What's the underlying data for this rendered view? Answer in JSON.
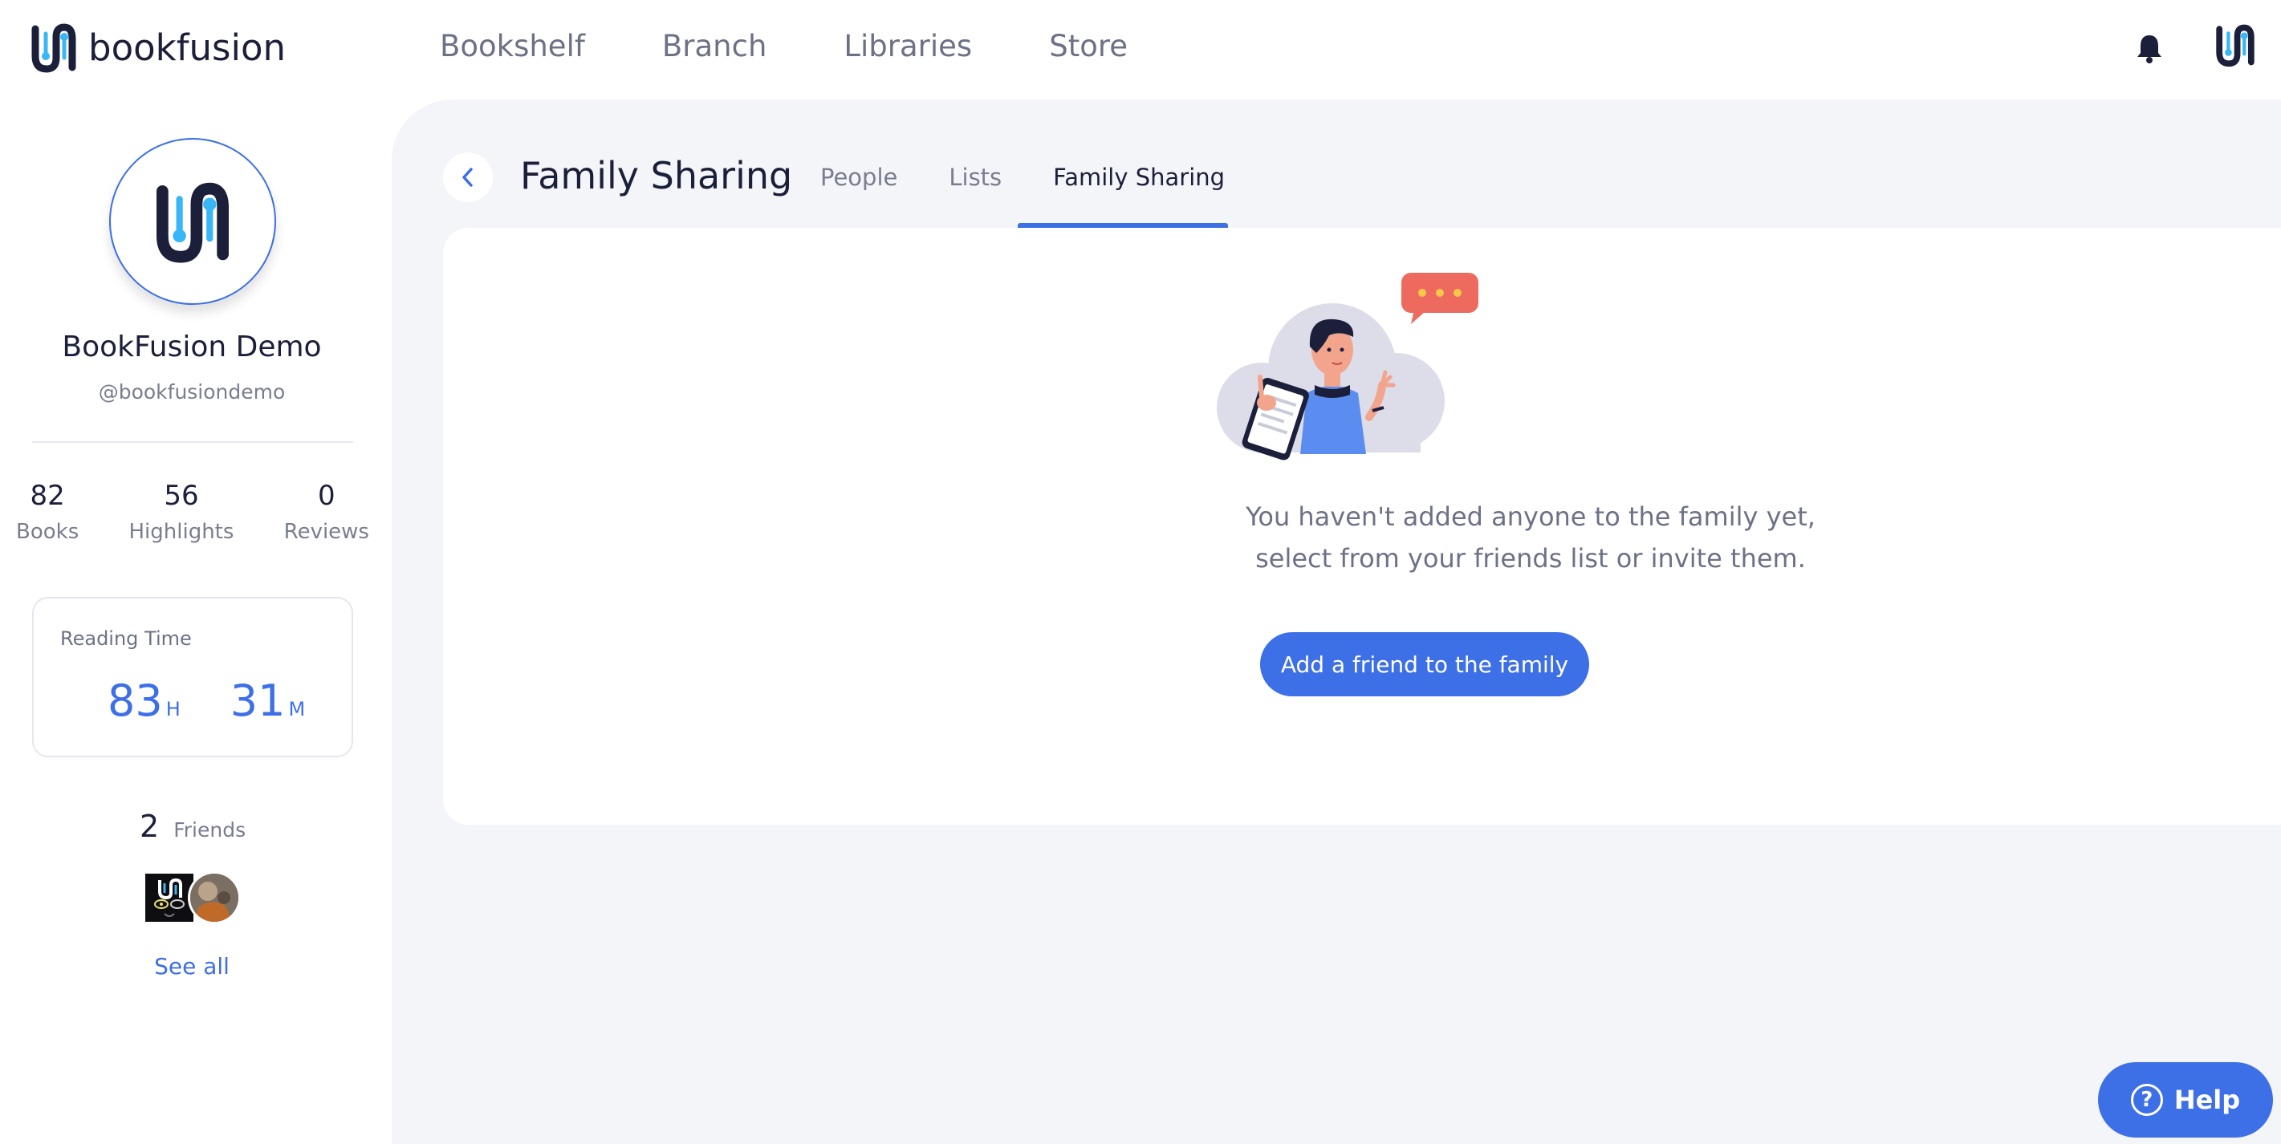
{
  "brand": {
    "name": "bookfusion",
    "color": "#3d6fe6"
  },
  "nav": {
    "items": [
      {
        "label": "Bookshelf"
      },
      {
        "label": "Branch"
      },
      {
        "label": "Libraries"
      },
      {
        "label": "Store"
      }
    ],
    "icons": [
      "bell-icon",
      "user-avatar"
    ]
  },
  "profile": {
    "name": "BookFusion Demo",
    "handle": "@bookfusiondemo",
    "stats": [
      {
        "value": "82",
        "label": "Books"
      },
      {
        "value": "56",
        "label": "Highlights"
      },
      {
        "value": "0",
        "label": "Reviews"
      }
    ],
    "reading_time": {
      "title": "Reading Time",
      "hours": "83",
      "hours_unit": "H",
      "minutes": "31",
      "minutes_unit": "M"
    },
    "friends": {
      "count": "2",
      "label": "Friends",
      "see_all": "See all"
    }
  },
  "page": {
    "title": "Family Sharing",
    "tabs": [
      {
        "label": "People",
        "active": false
      },
      {
        "label": "Lists",
        "active": false
      },
      {
        "label": "Family Sharing",
        "active": true
      }
    ],
    "empty_state": {
      "line1": "You haven't added anyone to the family yet,",
      "line2": "select from your friends list or invite them.",
      "button": "Add a friend to the family"
    }
  },
  "help": {
    "label": "Help"
  }
}
